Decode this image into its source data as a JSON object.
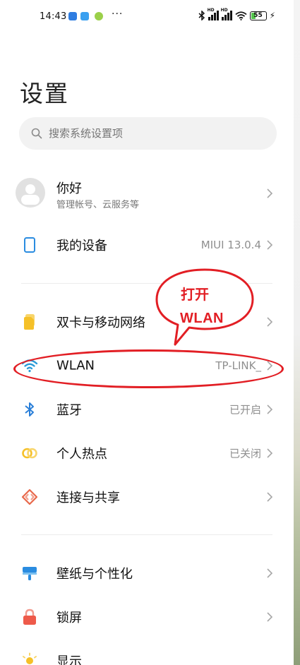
{
  "status_bar": {
    "time": "14:43",
    "dots": "···",
    "signal1_tag": "HD",
    "signal2_tag": "HD",
    "battery": "55"
  },
  "page": {
    "title": "设置"
  },
  "search": {
    "placeholder": "搜索系统设置项"
  },
  "profile": {
    "name": "你好",
    "subtitle": "管理帐号、云服务等"
  },
  "my_device": {
    "label": "我的设备",
    "value": "MIUI 13.0.4"
  },
  "network_items": [
    {
      "label": "双卡与移动网络",
      "value": "",
      "icon": "sim-card-icon"
    },
    {
      "label": "WLAN",
      "value": "TP-LINK_",
      "icon": "wifi-icon"
    },
    {
      "label": "蓝牙",
      "value": "已开启",
      "icon": "bluetooth-icon"
    },
    {
      "label": "个人热点",
      "value": "已关闭",
      "icon": "hotspot-icon"
    },
    {
      "label": "连接与共享",
      "value": "",
      "icon": "connection-share-icon"
    }
  ],
  "personal_items": [
    {
      "label": "壁纸与个性化",
      "icon": "wallpaper-icon"
    },
    {
      "label": "锁屏",
      "icon": "lock-icon"
    },
    {
      "label": "显示",
      "icon": "display-icon"
    }
  ],
  "annotation": {
    "line1": "打开",
    "line2": "WLAN",
    "color": "#e21e24"
  },
  "colors": {
    "wifi": "#2a9bd8",
    "bluetooth": "#2a7fd8",
    "sim": "#f5c028",
    "hotspot": "#f5c028",
    "share": "#e8684a",
    "wallpaper": "#2a8ce0",
    "lock": "#ee5a4a",
    "display": "#f5c028",
    "device": "#2a8ce0"
  }
}
